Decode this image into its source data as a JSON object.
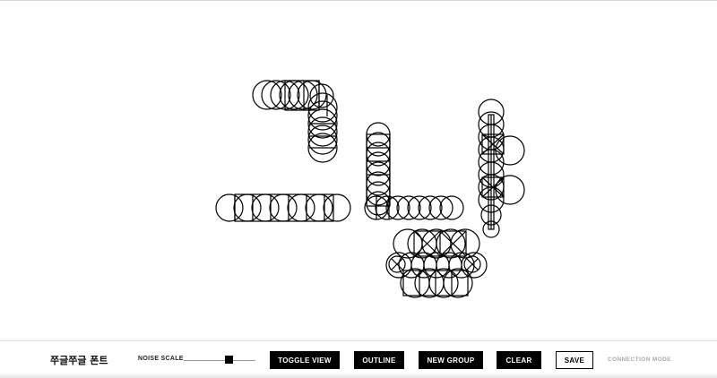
{
  "app": {
    "title": "쭈글쭈글 폰트"
  },
  "controls": {
    "noise_scale_label": "NOISE SCALE",
    "noise_scale_value": 0.65
  },
  "buttons": {
    "toggle_view": "TOGGLE VIEW",
    "outline": "OUTLINE",
    "new_group": "NEW GROUP",
    "clear": "CLEAR",
    "save": "SAVE"
  },
  "connection_mode": "CONNECTION MODE",
  "colors": {
    "stroke": "#000000",
    "background": "#ffffff",
    "muted": "#aaaaaa"
  }
}
